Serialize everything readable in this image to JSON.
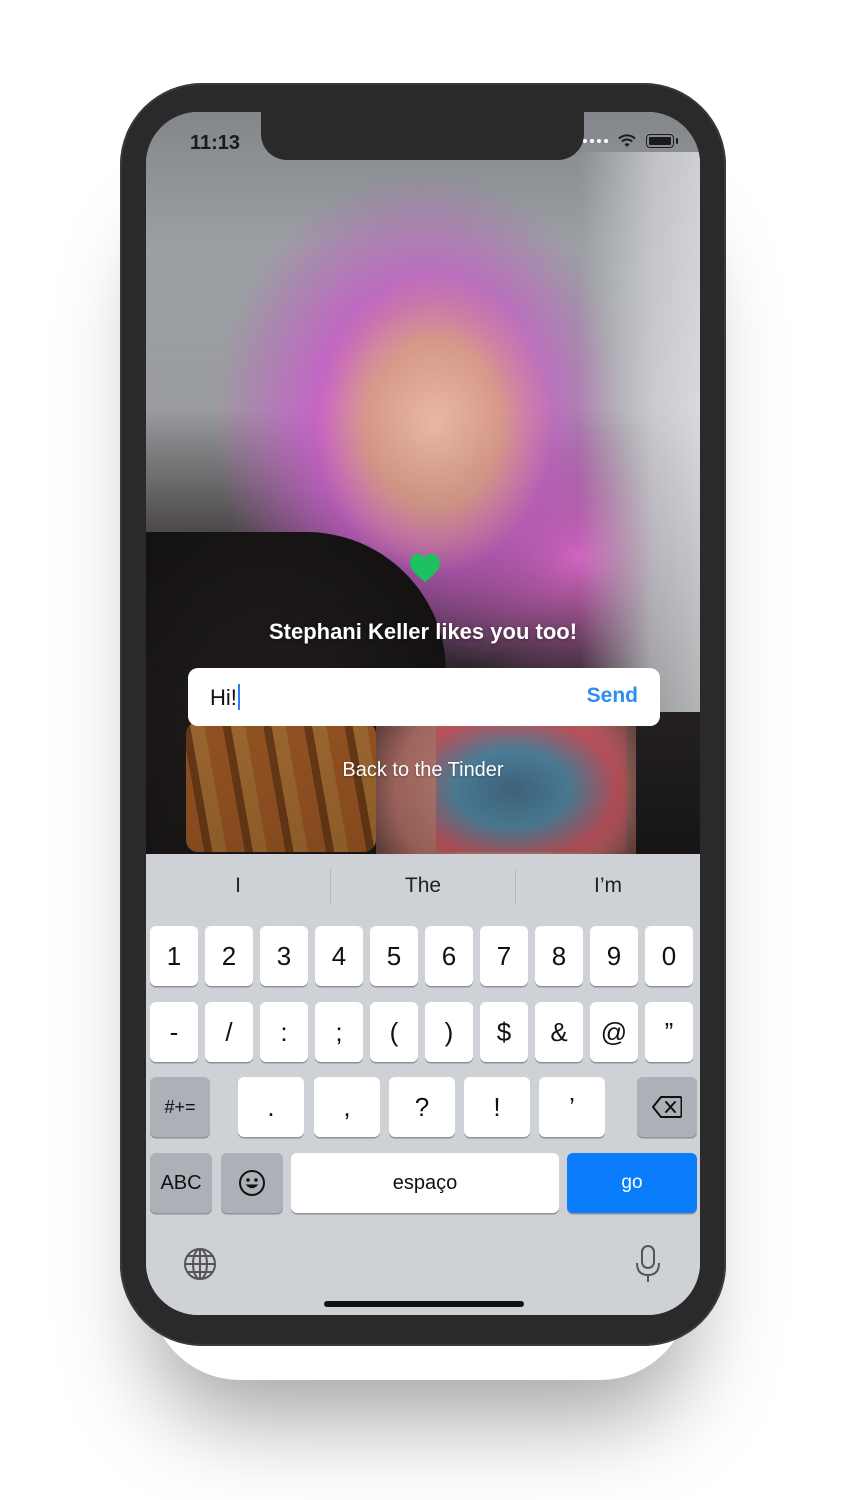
{
  "status_bar": {
    "time": "11:13"
  },
  "match": {
    "text": "Stephani Keller likes you too!",
    "heart_color": "#1ec15f"
  },
  "message": {
    "value": "Hi!",
    "send_label": "Send"
  },
  "back_link": "Back to the Tinder",
  "keyboard": {
    "suggestions": [
      "I",
      "The",
      "I’m"
    ],
    "row1": [
      "1",
      "2",
      "3",
      "4",
      "5",
      "6",
      "7",
      "8",
      "9",
      "0"
    ],
    "row2": [
      "-",
      "/",
      ":",
      ";",
      "(",
      ")",
      "$",
      "&",
      "@",
      "”"
    ],
    "row3": [
      ".",
      ",",
      "?",
      "!",
      "’"
    ],
    "symbols_label": "#+=",
    "abc_label": "ABC",
    "space_label": "espaço",
    "go_label": "go",
    "go_color": "#0a7dfc",
    "icons": [
      "emoji-icon",
      "backspace-icon",
      "globe-icon",
      "microphone-icon"
    ]
  }
}
